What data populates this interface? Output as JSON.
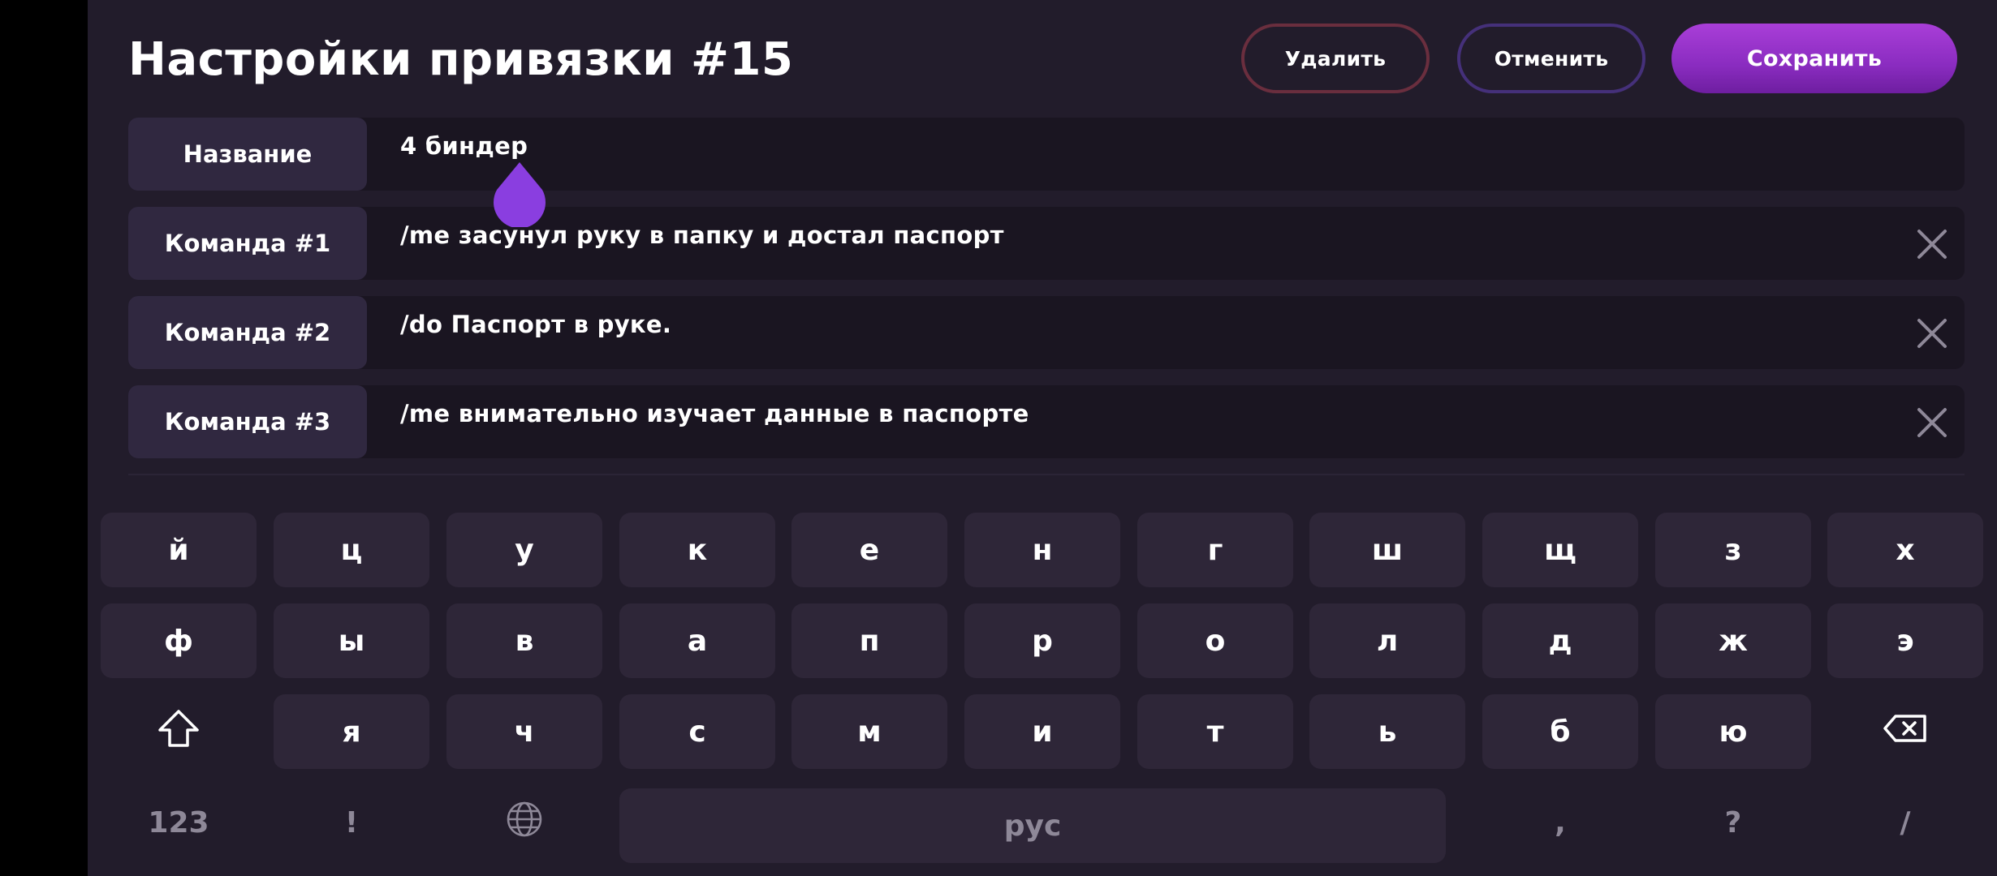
{
  "header": {
    "title": "Настройки привязки #15",
    "delete_label": "Удалить",
    "cancel_label": "Отменить",
    "save_label": "Сохранить"
  },
  "form": {
    "rows": [
      {
        "label": "Название",
        "value": "4 биндер"
      },
      {
        "label": "Команда #1",
        "value": "/me засунул руку в папку и достал паспорт"
      },
      {
        "label": "Команда #2",
        "value": "/do Паспорт в руке."
      },
      {
        "label": "Команда #3",
        "value": "/me внимательно изучает данные в паспорте"
      }
    ],
    "clear_icon": "close-icon"
  },
  "keyboard": {
    "row1": [
      "й",
      "ц",
      "у",
      "к",
      "е",
      "н",
      "г",
      "ш",
      "щ",
      "з",
      "х"
    ],
    "row2": [
      "ф",
      "ы",
      "в",
      "а",
      "п",
      "р",
      "о",
      "л",
      "д",
      "ж",
      "э"
    ],
    "row3": [
      "я",
      "ч",
      "с",
      "м",
      "и",
      "т",
      "ь",
      "б",
      "ю"
    ],
    "numbers_label": "123",
    "exclaim_label": "!",
    "space_label": "рус",
    "comma_label": ",",
    "question_label": "?",
    "slash_label": "/",
    "icons": {
      "shift": "shift-icon",
      "globe": "globe-icon",
      "backspace": "backspace-icon"
    }
  },
  "colors": {
    "background": "#221c2b",
    "field": "#1a1521",
    "label": "#302840",
    "key": "#2e2638",
    "accent": "#8a2cc0",
    "delete_border": "#6a2e3e",
    "cancel_border": "#45307a"
  }
}
